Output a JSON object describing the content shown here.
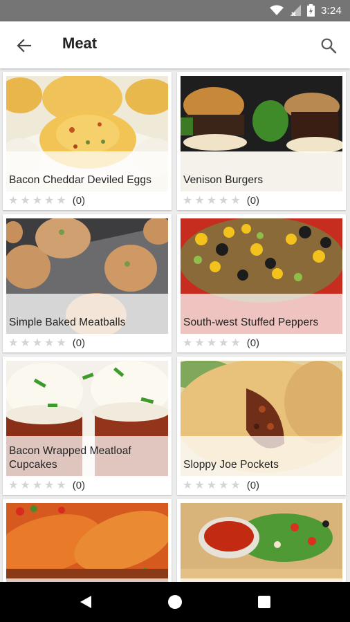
{
  "status_bar": {
    "time": "3:24"
  },
  "toolbar": {
    "title": "Meat"
  },
  "recipes": [
    {
      "name": "Bacon Cheddar Deviled Eggs",
      "rating": 0,
      "rating_count": "(0)"
    },
    {
      "name": "Venison Burgers",
      "rating": 0,
      "rating_count": "(0)"
    },
    {
      "name": "Simple Baked Meatballs",
      "rating": 0,
      "rating_count": "(0)"
    },
    {
      "name": "South-west Stuffed Peppers",
      "rating": 0,
      "rating_count": "(0)"
    },
    {
      "name": "Bacon Wrapped Meatloaf Cupcakes",
      "rating": 0,
      "rating_count": "(0)"
    },
    {
      "name": "Sloppy Joe Pockets",
      "rating": 0,
      "rating_count": "(0)"
    },
    {
      "name": "",
      "rating": 0,
      "rating_count": ""
    },
    {
      "name": "",
      "rating": 0,
      "rating_count": ""
    }
  ]
}
